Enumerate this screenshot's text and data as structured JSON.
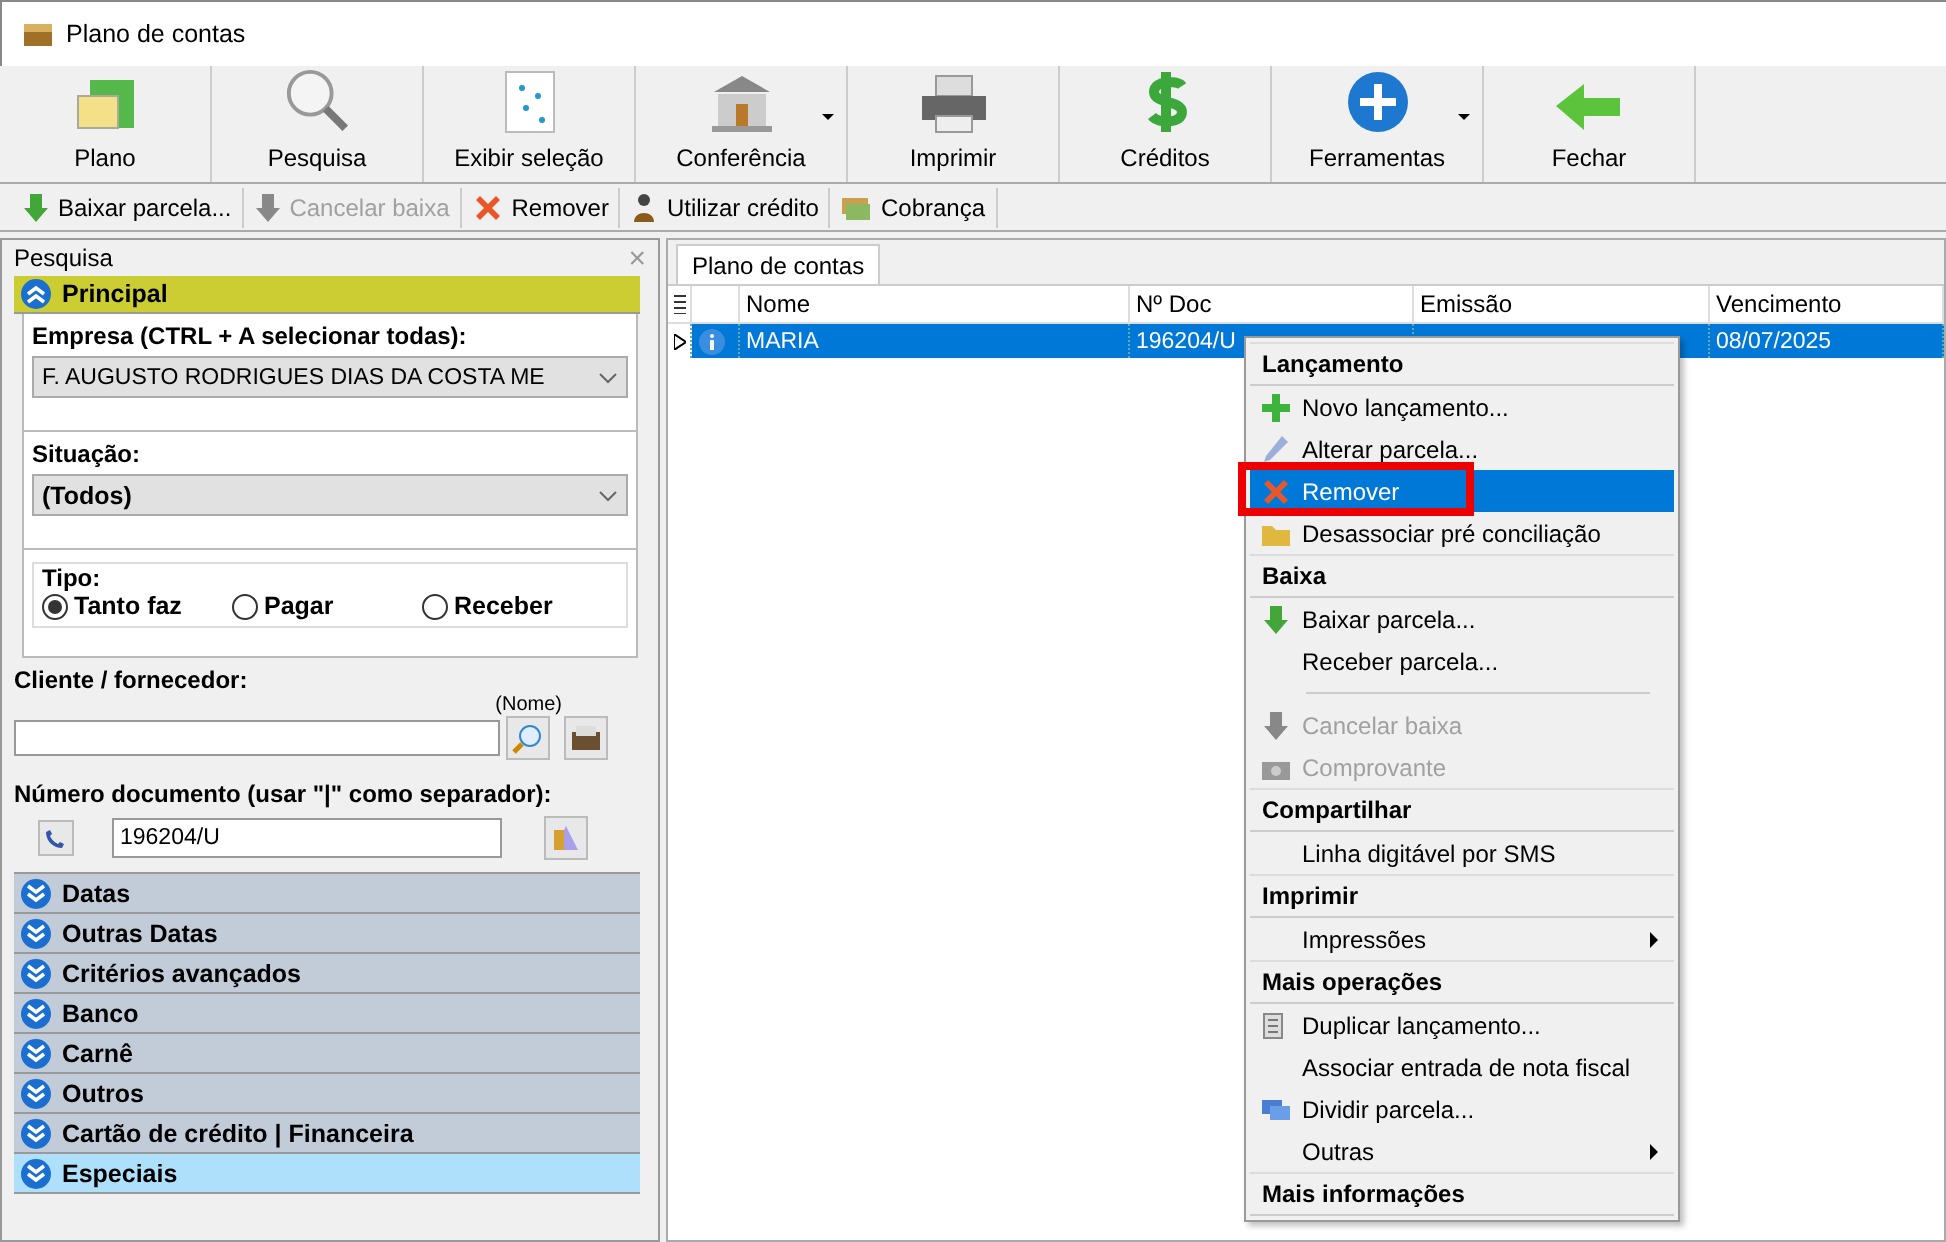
{
  "window": {
    "title": "Plano de contas"
  },
  "toolbar": [
    {
      "label": "Plano",
      "dropdown": false
    },
    {
      "label": "Pesquisa",
      "dropdown": false
    },
    {
      "label": "Exibir seleção",
      "dropdown": false
    },
    {
      "label": "Conferência",
      "dropdown": true
    },
    {
      "label": "Imprimir",
      "dropdown": false
    },
    {
      "label": "Créditos",
      "dropdown": false
    },
    {
      "label": "Ferramentas",
      "dropdown": true
    },
    {
      "label": "Fechar",
      "dropdown": false
    }
  ],
  "action_bar": [
    {
      "label": "Baixar parcela...",
      "disabled": false
    },
    {
      "label": "Cancelar baixa",
      "disabled": true
    },
    {
      "label": "Remover",
      "disabled": false
    },
    {
      "label": "Utilizar crédito",
      "disabled": false
    },
    {
      "label": "Cobrança",
      "disabled": false
    }
  ],
  "search_panel": {
    "title": "Pesquisa",
    "close": "×",
    "principal": {
      "title": "Principal",
      "expanded": true
    },
    "empresa": {
      "label": "Empresa (CTRL + A selecionar todas):",
      "value": "F. AUGUSTO RODRIGUES DIAS DA COSTA ME"
    },
    "situacao": {
      "label": "Situação:",
      "value": "(Todos)"
    },
    "tipo": {
      "label": "Tipo:",
      "options": [
        {
          "label": "Tanto faz",
          "selected": true
        },
        {
          "label": "Pagar",
          "selected": false
        },
        {
          "label": "Receber",
          "selected": false
        }
      ]
    },
    "cliente": {
      "label": "Cliente / fornecedor:",
      "hint": "(Nome)"
    },
    "numero": {
      "label": "Número documento (usar \"|\" como separador):",
      "value": "196204/U"
    },
    "sections": [
      {
        "title": "Datas",
        "selected": false
      },
      {
        "title": "Outras Datas",
        "selected": false
      },
      {
        "title": "Critérios avançados",
        "selected": false
      },
      {
        "title": "Banco",
        "selected": false
      },
      {
        "title": "Carnê",
        "selected": false
      },
      {
        "title": "Outros",
        "selected": false
      },
      {
        "title": "Cartão de crédito | Financeira",
        "selected": false
      },
      {
        "title": "Especiais",
        "selected": true
      }
    ]
  },
  "tab": {
    "label": "Plano de contas",
    "selected": true
  },
  "table": {
    "columns": [
      "Nome",
      "Nº Doc",
      "Emissão",
      "Vencimento"
    ],
    "rows": [
      {
        "selected": true,
        "cells": [
          "MARIA",
          "196204/U",
          "",
          "08/07/2025"
        ]
      }
    ]
  },
  "context_menu": [
    {
      "kind": "header",
      "label": "Lançamento"
    },
    {
      "kind": "item",
      "label": "Novo lançamento...",
      "disabled": false,
      "selected": false
    },
    {
      "kind": "item",
      "label": "Alterar parcela...",
      "disabled": false,
      "selected": false
    },
    {
      "kind": "item",
      "label": "Remover",
      "disabled": false,
      "selected": true,
      "highlighted": true
    },
    {
      "kind": "item",
      "label": "Desassociar pré conciliação",
      "disabled": false,
      "selected": false
    },
    {
      "kind": "header",
      "label": "Baixa"
    },
    {
      "kind": "item",
      "label": "Baixar parcela...",
      "disabled": false,
      "selected": false
    },
    {
      "kind": "item",
      "label": "Receber parcela...",
      "disabled": false,
      "selected": false
    },
    {
      "kind": "separator"
    },
    {
      "kind": "item",
      "label": "Cancelar baixa",
      "disabled": true,
      "selected": false
    },
    {
      "kind": "item",
      "label": "Comprovante",
      "disabled": true,
      "selected": false
    },
    {
      "kind": "header",
      "label": "Compartilhar"
    },
    {
      "kind": "item",
      "label": "Linha digitável por SMS",
      "disabled": false,
      "selected": false
    },
    {
      "kind": "header",
      "label": "Imprimir"
    },
    {
      "kind": "item",
      "label": "Impressões",
      "disabled": false,
      "selected": false,
      "submenu": true
    },
    {
      "kind": "header",
      "label": "Mais operações"
    },
    {
      "kind": "item",
      "label": "Duplicar lançamento...",
      "disabled": false,
      "selected": false
    },
    {
      "kind": "item",
      "label": "Associar entrada de nota fiscal",
      "disabled": false,
      "selected": false
    },
    {
      "kind": "item",
      "label": "Dividir parcela...",
      "disabled": false,
      "selected": false
    },
    {
      "kind": "item",
      "label": "Outras",
      "disabled": false,
      "selected": false,
      "submenu": true
    },
    {
      "kind": "header",
      "label": "Mais informações"
    }
  ]
}
